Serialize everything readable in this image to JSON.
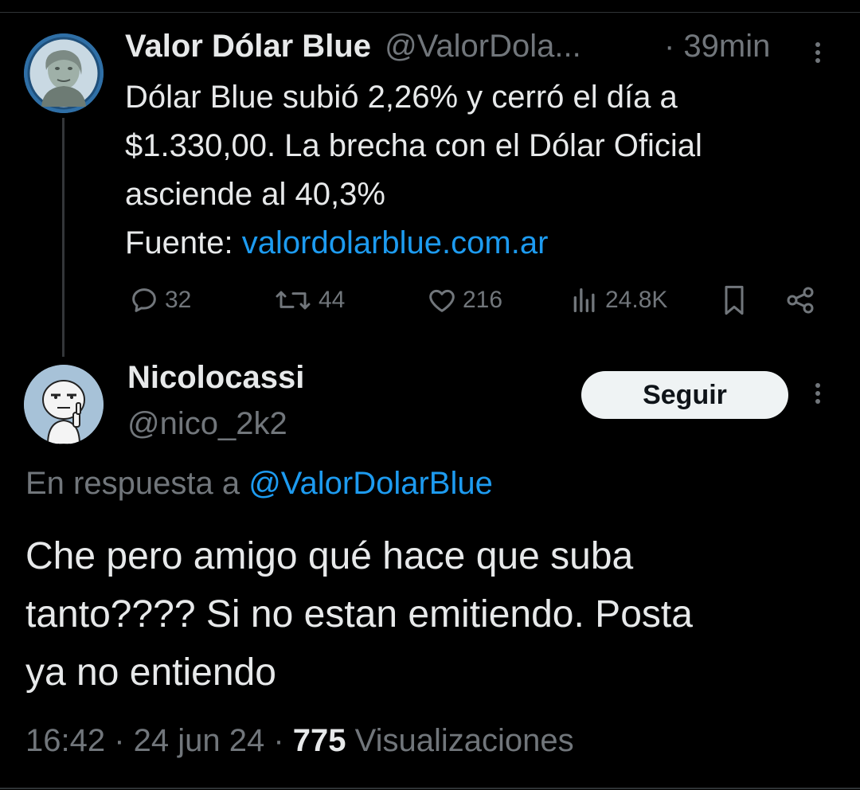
{
  "original_tweet": {
    "author_name": "Valor Dólar Blue",
    "handle": "@ValorDola...",
    "time": "· 39min",
    "text_lines": [
      "Dólar Blue subió 2,26% y cerró el día a",
      "$1.330,00. La brecha con el Dólar Oficial",
      "asciende al 40,3%"
    ],
    "source_label": "Fuente: ",
    "source_link": "valordolarblue.com.ar",
    "stats": {
      "replies": "32",
      "retweets": "44",
      "likes": "216",
      "views": "24.8K"
    },
    "icons": [
      "verified-avatar",
      "reply-icon",
      "retweet-icon",
      "heart-icon",
      "views-icon",
      "bookmark-icon",
      "share-icon",
      "more-icon"
    ]
  },
  "reply_tweet": {
    "author_name": "Nicolocassi",
    "handle": "@nico_2k2",
    "follow_label": "Seguir",
    "reply_prefix": "En respuesta a ",
    "reply_mention": "@ValorDolarBlue",
    "text_lines": [
      "Che pero amigo qué hace que suba",
      "tanto???? Si no estan emitiendo. Posta",
      "ya no entiendo"
    ],
    "time": "16:42",
    "sep1": " · ",
    "date": "24 jun 24",
    "sep2": " · ",
    "views_count": "775",
    "views_label": " Visualizaciones"
  },
  "colors": {
    "background": "#000000",
    "text": "#e7e9ea",
    "muted": "#71767b",
    "link": "#1d9bf0",
    "button_bg": "#eff3f4"
  }
}
